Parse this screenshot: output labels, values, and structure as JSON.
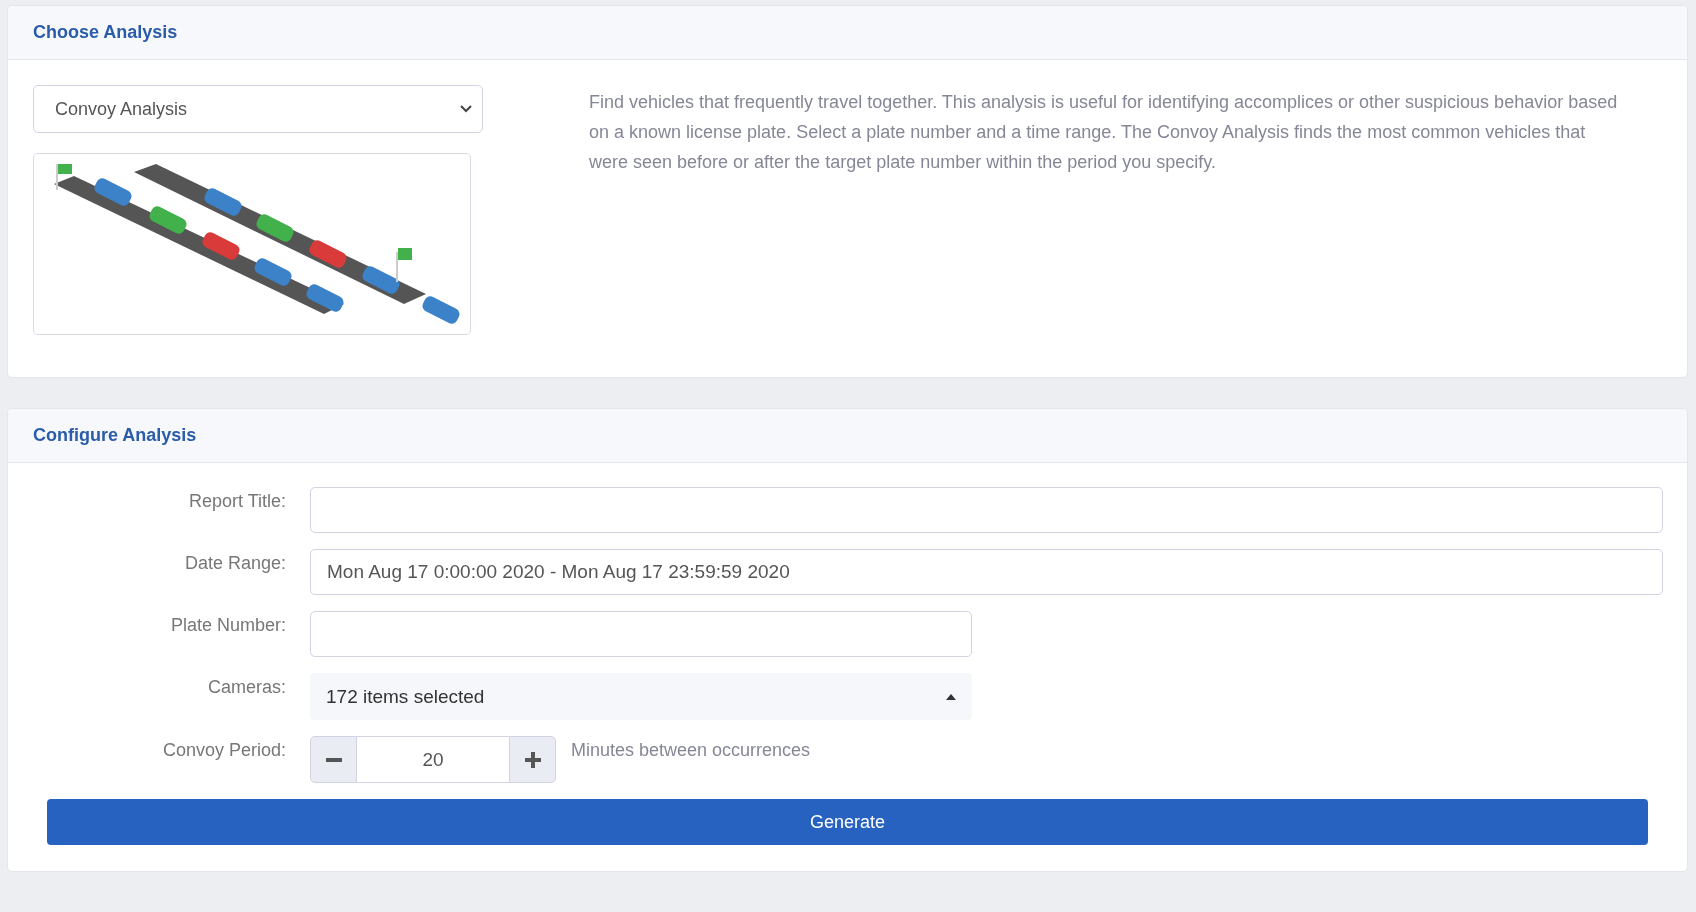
{
  "choose_analysis": {
    "title": "Choose Analysis",
    "analysis_select": {
      "value": "Convoy Analysis"
    },
    "description": "Find vehicles that frequently travel together. This analysis is useful for identifying accomplices or other suspicious behavior based on a known license plate. Select a plate number and a time range. The Convoy Analysis finds the most common vehicles that were seen before or after the target plate number within the period you specify."
  },
  "configure_analysis": {
    "title": "Configure Analysis",
    "fields": [
      {
        "kind": "text",
        "label": "Report Title:",
        "wide": true
      },
      {
        "kind": "text",
        "label": "Date Range:",
        "value": "Mon Aug 17 0:00:00 2020 - Mon Aug 17 23:59:59 2020",
        "wide": true
      },
      {
        "kind": "text",
        "label": "Plate Number:",
        "wide": false
      },
      {
        "kind": "multiselect",
        "label": "Cameras:",
        "value": "172 items selected",
        "expanded": true
      },
      {
        "kind": "stepper",
        "label": "Convoy Period:",
        "value": "20",
        "hint": "Minutes between occurrences"
      }
    ],
    "generate_button": "Generate"
  }
}
